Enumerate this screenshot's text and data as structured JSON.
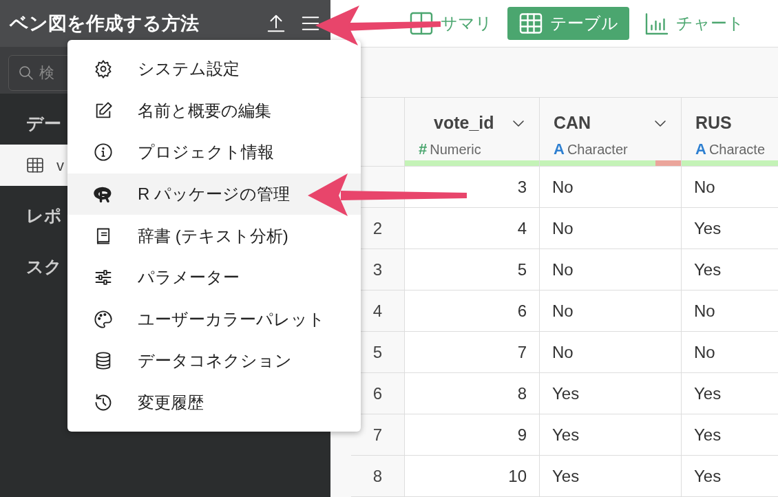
{
  "sidebar": {
    "title": "ベン図を作成する方法",
    "search": {
      "placeholder": "検"
    },
    "items": [
      {
        "label": "デー",
        "kind": "section",
        "selected": false
      },
      {
        "label": "v",
        "kind": "table",
        "selected": true
      },
      {
        "label": "レポ",
        "kind": "section",
        "selected": false
      },
      {
        "label": "スク",
        "kind": "section",
        "selected": false
      }
    ]
  },
  "menu": {
    "items": [
      {
        "label": "システム設定",
        "kind": "gear",
        "selected": false
      },
      {
        "label": "名前と概要の編集",
        "kind": "edit",
        "selected": false
      },
      {
        "label": "プロジェクト情報",
        "kind": "info",
        "selected": false
      },
      {
        "label": "R パッケージの管理",
        "kind": "rlogo",
        "selected": true
      },
      {
        "label": "辞書 (テキスト分析)",
        "kind": "book",
        "selected": false
      },
      {
        "label": "パラメーター",
        "kind": "sliders",
        "selected": false
      },
      {
        "label": "ユーザーカラーパレット",
        "kind": "palette",
        "selected": false
      },
      {
        "label": "データコネクション",
        "kind": "database",
        "selected": false
      },
      {
        "label": "変更履歴",
        "kind": "history",
        "selected": false
      }
    ]
  },
  "tabs": [
    {
      "label": "サマリ",
      "kind": "summary",
      "selected": false
    },
    {
      "label": "テーブル",
      "kind": "table",
      "selected": true
    },
    {
      "label": "チャート",
      "kind": "chart",
      "selected": false
    }
  ],
  "table": {
    "columns": [
      {
        "name": "vote_id",
        "type": "Numeric",
        "type_icon": "#",
        "kind": "numeric",
        "caret": true,
        "level": 1
      },
      {
        "name": "CAN",
        "type": "Character",
        "type_icon": "A",
        "kind": "character",
        "caret": true,
        "level": 0.82
      },
      {
        "name": "RUS",
        "type": "Characte",
        "type_icon": "A",
        "kind": "character",
        "caret": false,
        "level": 1
      }
    ],
    "rows": [
      {
        "cells": [
          "3",
          "No",
          "No"
        ]
      },
      {
        "number": "2",
        "cells": [
          "4",
          "No",
          "Yes"
        ]
      },
      {
        "number": "3",
        "cells": [
          "5",
          "No",
          "Yes"
        ]
      },
      {
        "number": "4",
        "cells": [
          "6",
          "No",
          "No"
        ]
      },
      {
        "number": "5",
        "cells": [
          "7",
          "No",
          "No"
        ]
      },
      {
        "number": "6",
        "cells": [
          "8",
          "Yes",
          "Yes"
        ]
      },
      {
        "number": "7",
        "cells": [
          "9",
          "Yes",
          "Yes"
        ]
      },
      {
        "number": "8",
        "cells": [
          "10",
          "Yes",
          "Yes"
        ]
      }
    ]
  }
}
